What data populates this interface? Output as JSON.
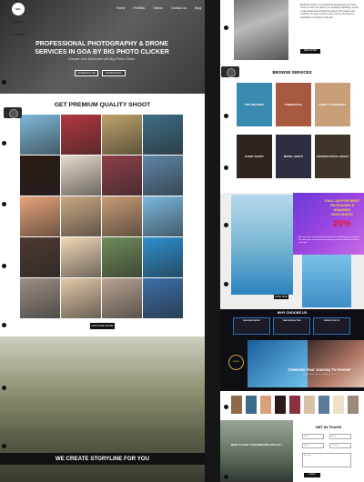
{
  "header": {
    "logo_text": "BIG PHOTO CLICKER",
    "nav": [
      "Home",
      "Portfolio",
      "Videos",
      "Contact Us",
      "Blog"
    ]
  },
  "hero": {
    "title": "PROFESSIONAL PHOTOGRAPHY & DRONE SERVICES IN GOA BY BIG PHOTO CLICKER",
    "subtitle": "Elevate Your Memories with Big Photo Clicker",
    "btn_contact": "CONTACT US",
    "btn_portfolio": "PORTFOLIO"
  },
  "gallery": {
    "title": "GET PREMIUM QUALITY SHOOT",
    "explore_label": "EXPLORE MORE",
    "colors": [
      [
        "#7eb9d9",
        "#b3373f",
        "#bfa46a",
        "#3e6e86"
      ],
      [
        "#2a1a14",
        "#e6dccb",
        "#8e3f4a",
        "#5f86a8"
      ],
      [
        "#e8a47a",
        "#caa983",
        "#c99c76",
        "#7bb9de"
      ],
      [
        "#4d3a32",
        "#f0d7b7",
        "#6f8b5a",
        "#2e8fcf"
      ],
      [
        "#9c8f85",
        "#e2c8a8",
        "#b9a393",
        "#3b6fa7"
      ]
    ]
  },
  "story": {
    "banner": "WE CREATE STORYLINE FOR YOU"
  },
  "about": {
    "text": "Big Photo Clicker is a professional photography and drone service in Goa. We capture pre-weddings, weddings, events, model shoots and architectural projects with passion and creativity. Our team ensures every moment is preserved beautifully and delivered with care.",
    "btn": "READ MORE"
  },
  "services": {
    "title": "BROWSE SERVICES",
    "items": [
      {
        "label": "PRE-WEDDING",
        "color": "#3a8ab0"
      },
      {
        "label": "COMMERCIAL",
        "color": "#a75a40"
      },
      {
        "label": "FAMILY & MATERNITY",
        "color": "#c89f78"
      },
      {
        "label": "EVENT SHOOT",
        "color": "#2d2420"
      },
      {
        "label": "MODEL SHOOT",
        "color": "#2b2f3f"
      },
      {
        "label": "ARCHITECTURAL SHOOT",
        "color": "#3e3428"
      }
    ]
  },
  "promo": {
    "headline": "CALL US FOR BEST PACKAGES & AMAZING DISCOUNTS",
    "discount": "20%",
    "body": "We are a team of dedicated photographers who bring your dreams to life. Book your shoot today and enjoy an exclusive discount on all our packages.",
    "btn": "BOOK NOW"
  },
  "why": {
    "title": "WHY CHOOSE US",
    "pills": [
      "HIGH-END EDITING",
      "TIME SATISFACTION",
      "CREATIVE SHOTS"
    ],
    "award": "AWARD",
    "heading": "Celebrate Your Journey To Forever",
    "sub": "with Big Photo Clicker's wedding services"
  },
  "strip": {
    "colors": [
      "#8c6a4a",
      "#3c6a8a",
      "#d8a07a",
      "#2a1a1a",
      "#8c2f3f",
      "#d8c0a8",
      "#5a7a9a",
      "#f0e0c8",
      "#9a8a7a"
    ]
  },
  "contact": {
    "image_text": "WANT TO SAVE YOUR MEMORIES WITH US ?",
    "title": "GET IN TOUCH",
    "fields": [
      "Name",
      "Email",
      "Phone",
      "Location",
      "Message"
    ],
    "btn": "SUBMIT"
  }
}
